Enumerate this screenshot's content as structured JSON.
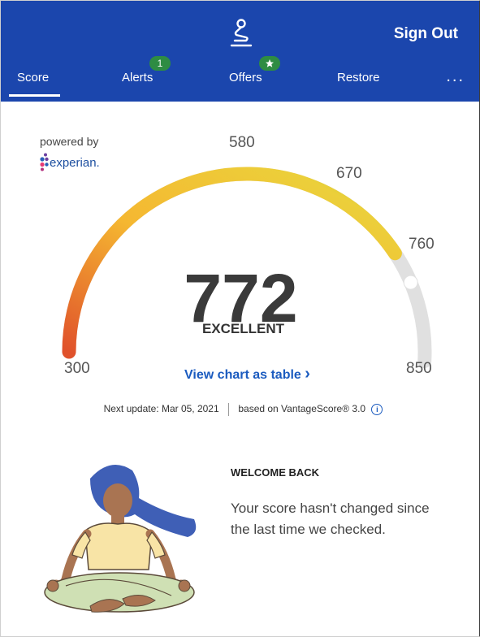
{
  "header": {
    "sign_out": "Sign Out",
    "tabs": [
      {
        "label": "Score",
        "active": true
      },
      {
        "label": "Alerts",
        "badge": "1"
      },
      {
        "label": "Offers",
        "badge_icon": "star-icon"
      },
      {
        "label": "Restore"
      }
    ],
    "more": "..."
  },
  "powered_by": "powered by",
  "brand": "experian.",
  "gauge": {
    "ticks": [
      "300",
      "580",
      "670",
      "760",
      "850"
    ],
    "score": "772",
    "rating": "EXCELLENT",
    "min": 300,
    "max": 850,
    "value": 772,
    "colors": {
      "track": "#e0e0e0",
      "start": "#e0522b",
      "mid": "#f5b731",
      "end": "#b8cf2c",
      "marker": "#ffffff"
    }
  },
  "view_table": "View chart as table",
  "view_table_chevron": "›",
  "next_update": "Next update: Mar 05, 2021",
  "based_on": "based on VantageScore® 3.0",
  "info_icon_glyph": "i",
  "welcome": {
    "heading": "WELCOME BACK",
    "body": "Your score hasn't changed since the last time we checked."
  },
  "colors": {
    "brand": "#1b46ad",
    "badge": "#2e8c43",
    "link": "#1b5bbf"
  }
}
